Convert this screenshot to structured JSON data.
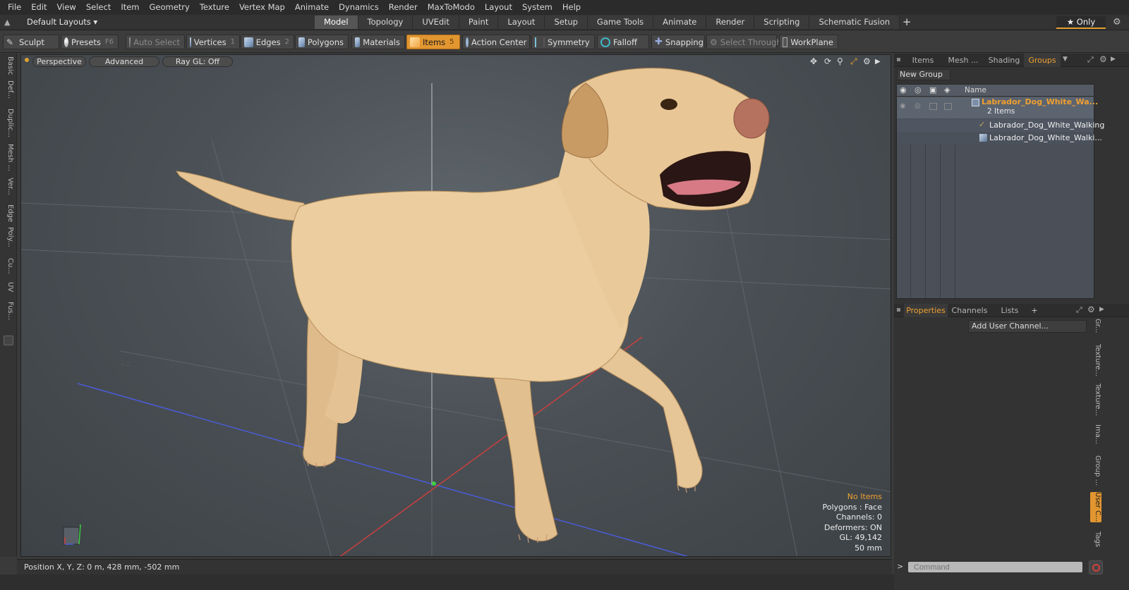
{
  "menu": [
    "File",
    "Edit",
    "View",
    "Select",
    "Item",
    "Geometry",
    "Texture",
    "Vertex Map",
    "Animate",
    "Dynamics",
    "Render",
    "MaxToModo",
    "Layout",
    "System",
    "Help"
  ],
  "layout_selector": "Default Layouts ▾",
  "tabs": [
    {
      "label": "Model",
      "active": true
    },
    {
      "label": "Topology",
      "active": false
    },
    {
      "label": "UVEdit",
      "active": false
    },
    {
      "label": "Paint",
      "active": false
    },
    {
      "label": "Layout",
      "active": false
    },
    {
      "label": "Setup",
      "active": false
    },
    {
      "label": "Game Tools",
      "active": false
    },
    {
      "label": "Animate",
      "active": false
    },
    {
      "label": "Render",
      "active": false
    },
    {
      "label": "Scripting",
      "active": false
    },
    {
      "label": "Schematic Fusion",
      "active": false
    }
  ],
  "tab_add": "+",
  "only_button": "★ Only",
  "toolbar": {
    "sculpt": "Sculpt",
    "presets": "Presets",
    "presets_key": "F6",
    "auto_select": "Auto Select",
    "vertices": "Vertices",
    "vertices_key": "1",
    "edges": "Edges",
    "edges_key": "2",
    "polygons": "Polygons",
    "materials": "Materials",
    "items": "Items",
    "items_key": "5",
    "action_center": "Action Center",
    "symmetry": "Symmetry",
    "falloff": "Falloff",
    "snapping": "Snapping",
    "select_through": "Select Through",
    "workplane": "WorkPlane"
  },
  "left_tabs": [
    "Basic",
    "Def...",
    "Duplic...",
    "Mesh ...",
    "Ver...",
    "Edge",
    "Poly...",
    "Cu...",
    "UV",
    "Fus..."
  ],
  "viewport": {
    "view_mode": "Perspective",
    "shading_mode": "Advanced",
    "raygl": "Ray GL: Off",
    "axis_label": "+Z",
    "hud": {
      "selection": "No Items",
      "polygons": "Polygons : Face",
      "channels": "Channels: 0",
      "deformers": "Deformers: ON",
      "gl": "GL: 49,142",
      "distance": "50 mm"
    }
  },
  "status_bar": "Position X, Y, Z:   0 m, 428 mm, -502 mm",
  "groups_panel": {
    "tabs": [
      {
        "label": "Items",
        "active": false
      },
      {
        "label": "Mesh ...",
        "active": false
      },
      {
        "label": "Shading",
        "active": false
      },
      {
        "label": "Groups",
        "active": true
      }
    ],
    "new_group": "New Group",
    "name_header": "Name",
    "group_name": "Labrador_Dog_White_Wa...",
    "group_count": "2 Items",
    "children": [
      "Labrador_Dog_White_Walking",
      "Labrador_Dog_White_Walki..."
    ]
  },
  "properties_panel": {
    "tabs": [
      {
        "label": "Properties",
        "active": true
      },
      {
        "label": "Channels",
        "active": false
      },
      {
        "label": "Lists",
        "active": false
      }
    ],
    "tab_add": "+",
    "add_user_channel": "Add User Channel...",
    "side_tabs": [
      "Gr...",
      "Texture...",
      "Texture...",
      "Ima...",
      "Group ...",
      "User C...",
      "Tags"
    ]
  },
  "command": {
    "prompt": ">",
    "placeholder": "Command"
  },
  "colors": {
    "accent": "#e29630",
    "highlight_text": "#f0a030",
    "dog_fur": "#e8c99c"
  }
}
